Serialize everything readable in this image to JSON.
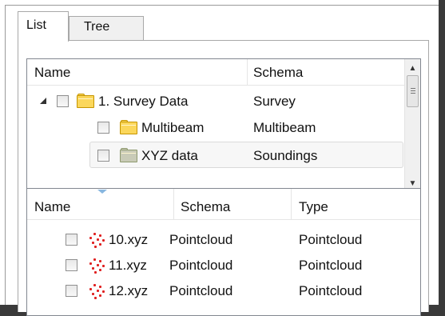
{
  "tabs": [
    {
      "label": "List",
      "active": true
    },
    {
      "label": "Tree",
      "active": false
    }
  ],
  "tree": {
    "columns": [
      "Name",
      "Schema"
    ],
    "rows": [
      {
        "name": "1. Survey Data",
        "schema": "Survey",
        "expanded": true,
        "level": 0,
        "icon": "folder-icon"
      },
      {
        "name": "Multibeam",
        "schema": "Multibeam",
        "level": 1,
        "icon": "folder-icon"
      },
      {
        "name": "XYZ data",
        "schema": "Soundings",
        "level": 1,
        "icon": "folder-icon",
        "selected": true
      }
    ]
  },
  "list": {
    "columns": [
      "Name",
      "Schema",
      "Type"
    ],
    "rows": [
      {
        "name": "10.xyz",
        "schema": "Pointcloud",
        "type": "Pointcloud",
        "icon": "pointcloud-icon"
      },
      {
        "name": "11.xyz",
        "schema": "Pointcloud",
        "type": "Pointcloud",
        "icon": "pointcloud-icon"
      },
      {
        "name": "12.xyz",
        "schema": "Pointcloud",
        "type": "Pointcloud",
        "icon": "pointcloud-icon"
      }
    ]
  },
  "colors": {
    "folder_yellow": "#fbd75b",
    "folder_grey": "#c9cbb7",
    "pointcloud_red": "#e02020",
    "sort_arrow": "#88b7e0"
  }
}
